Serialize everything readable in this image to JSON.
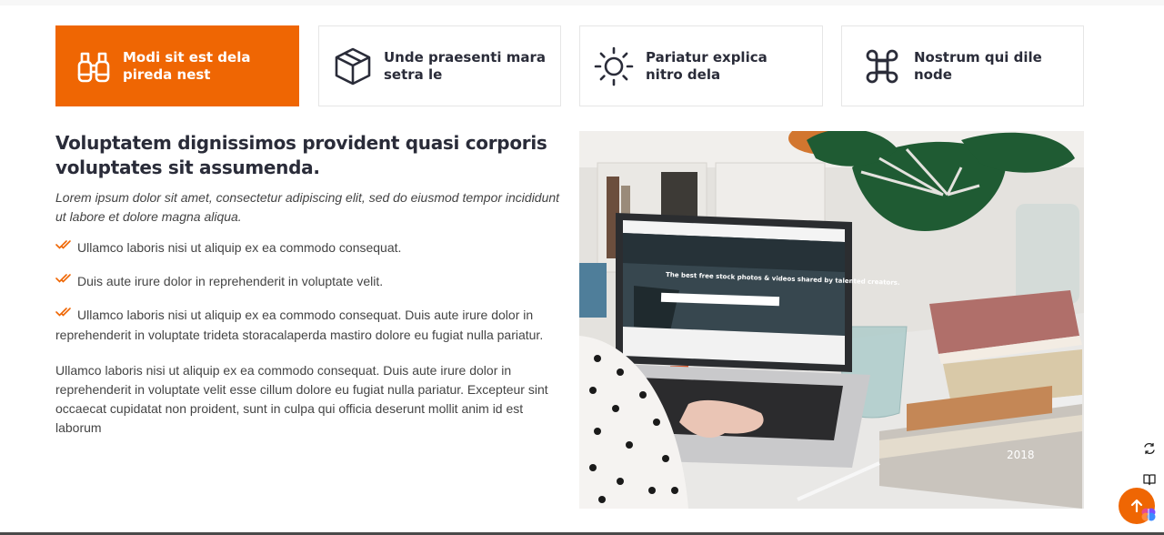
{
  "colors": {
    "accent": "#ef6603",
    "heading": "#2a2c39",
    "text": "#444444",
    "border": "#e6e6e6"
  },
  "tabs": [
    {
      "label": "Modi sit est dela pireda nest",
      "icon": "binoculars-icon",
      "active": true
    },
    {
      "label": "Unde praesenti mara setra le",
      "icon": "box-icon",
      "active": false
    },
    {
      "label": "Pariatur explica nitro dela",
      "icon": "sun-icon",
      "active": false
    },
    {
      "label": "Nostrum qui dile node",
      "icon": "command-icon",
      "active": false
    }
  ],
  "content": {
    "heading": "Voluptatem dignissimos provident quasi corporis voluptates sit assumenda.",
    "lead": "Lorem ipsum dolor sit amet, consectetur adipiscing elit, sed do eiusmod tempor incididunt ut labore et dolore magna aliqua.",
    "bullets": [
      "Ullamco laboris nisi ut aliquip ex ea commodo consequat.",
      "Duis aute irure dolor in reprehenderit in voluptate velit.",
      "Ullamco laboris nisi ut aliquip ex ea commodo consequat. Duis aute irure dolor in reprehenderit in voluptate trideta storacalaperda mastiro dolore eu fugiat nulla pariatur."
    ],
    "paragraph": "Ullamco laboris nisi ut aliquip ex ea commodo consequat. Duis aute irure dolor in reprehenderit in voluptate velit esse cillum dolore eu fugiat nulla pariatur. Excepteur sint occaecat cupidatat non proident, sunt in culpa qui officia deserunt mollit anim id est laborum"
  },
  "photo": {
    "screen_headline": "The best free stock photos & videos shared by talented creators.",
    "book_label": "2018"
  },
  "floating": {
    "icons": [
      "swap-icon",
      "book-icon",
      "brain-icon"
    ],
    "back_to_top_icon": "arrow-up-icon"
  }
}
